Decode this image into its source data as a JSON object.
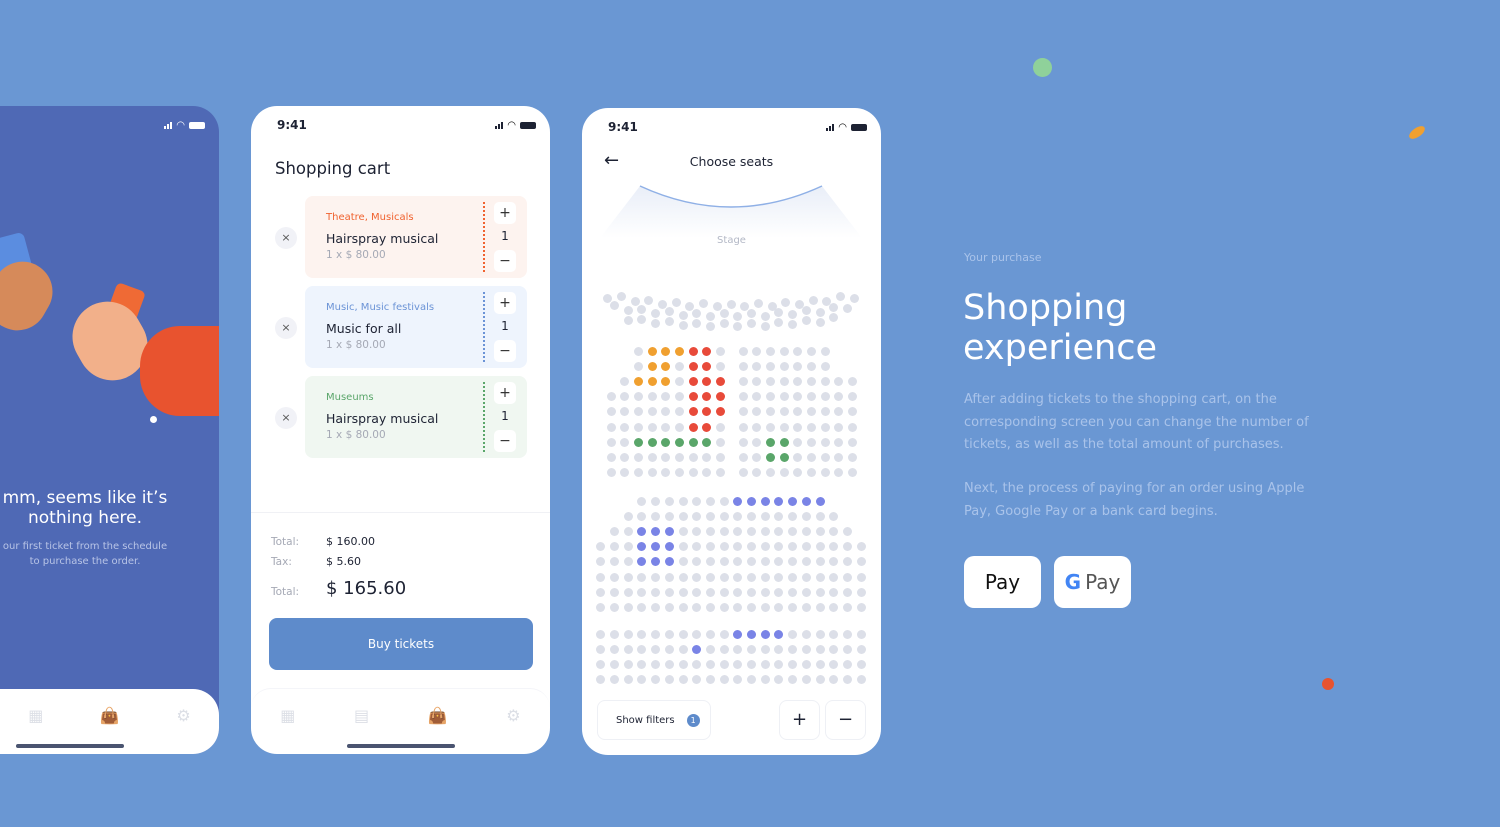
{
  "colors": {
    "background": "#6a97d3",
    "accent": "#5e8bcb",
    "orange_seat": "#f0a030",
    "red_seat": "#e84a3a",
    "green_seat": "#5aa66a",
    "blue_seat": "#7a84e6",
    "free_seat": "#dcdfe8"
  },
  "empty_screen": {
    "title_line1": "mm, seems like it’s",
    "title_line2": "nothing here.",
    "subtitle_line1": "our first ticket from the schedule",
    "subtitle_line2": "to purchase the order.",
    "nav": [
      "calendar-icon",
      "shopping-bag-icon",
      "gear-icon"
    ]
  },
  "cart": {
    "time": "9:41",
    "title": "Shopping cart",
    "items": [
      {
        "category": "Theatre, Musicals",
        "name": "Hairspray musical",
        "price": "1 x $ 80.00",
        "qty": "1",
        "color": "#f0622f",
        "bg": "#fdf3ef"
      },
      {
        "category": "Music, Music festivals",
        "name": "Music for all",
        "price": "1 x $ 80.00",
        "qty": "1",
        "color": "#6b93d6",
        "bg": "#eef4fd"
      },
      {
        "category": "Museums",
        "name": "Hairspray musical",
        "price": "1 x $ 80.00",
        "qty": "1",
        "color": "#5aa66a",
        "bg": "#f0f7f1"
      }
    ],
    "plus": "+",
    "minus": "−",
    "remove": "×",
    "subtotal_label": "Total:",
    "subtotal": "$ 160.00",
    "tax_label": "Tax:",
    "tax": "$ 5.60",
    "total_label": "Total:",
    "total": "$ 165.60",
    "buy": "Buy tickets",
    "nav": [
      "grid-icon",
      "calendar-icon",
      "shopping-bag-icon",
      "gear-icon"
    ]
  },
  "seats": {
    "time": "9:41",
    "title": "Choose seats",
    "stage": "Stage",
    "filters": "Show filters",
    "filter_count": "1",
    "zoom_in": "+",
    "zoom_out": "−",
    "left_block": [
      "..fooorrf",
      "..foofrrf",
      ".fooofrrr",
      "ffffffrrr",
      "ffffffrrr",
      "ffffffrrf",
      "ffggggggf",
      "fffffffff",
      "fffffffff"
    ],
    "right_block": [
      "fffffff",
      "fffffff",
      "fffffffff",
      "fffffffff",
      "fffffffff",
      "fffffffff",
      "ffggfffff",
      "ffggfffff",
      "fffffffff"
    ],
    "lower_block": [
      "fffffffbbbbbbb",
      "ffffffffffffffff",
      "ffbbbfffffffffffff",
      "fffbbbffffffffffffff",
      "fffbbbffffffffffffff",
      "ffffffffffffffffffff",
      "ffffffffffffffffffff",
      "ffffffffffffffffffff"
    ],
    "back_block": [
      "ffffffffffbbbbffffff",
      "fffffffbffffffffffff",
      "ffffffffffffffffffff",
      "ffffffffffffffffffff"
    ],
    "balcony_rows": [
      19,
      18,
      16
    ]
  },
  "info": {
    "eyebrow": "Your purchase",
    "title_line1": "Shopping",
    "title_line2": "experience",
    "p1": "After adding tickets to the shopping cart, on the corresponding screen you can change the number of tickets, as well as the total amount of purchases.",
    "p2": "Next, the process of paying for an order using Apple Pay, Google Pay or a bank card begins.",
    "apple_pay": "Pay",
    "google_pay": "Pay",
    "google_g": "G"
  }
}
